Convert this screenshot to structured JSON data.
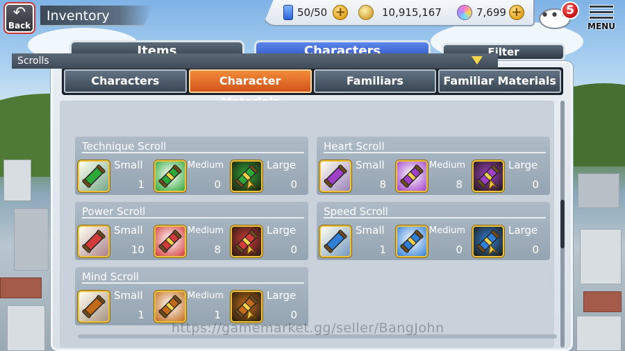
{
  "header": {
    "back_label": "Back",
    "title": "Inventory"
  },
  "status": {
    "energy": "50/50",
    "coins": "10,915,167",
    "gems": "7,699"
  },
  "chat": {
    "badge": "5",
    "dots": "•••"
  },
  "menu": {
    "label": "MENU"
  },
  "main_tabs": [
    {
      "label": "Items",
      "active": false
    },
    {
      "label": "Characters",
      "active": true
    }
  ],
  "filter_label": "Filter",
  "sub_tabs": [
    {
      "label": "Characters",
      "active": false
    },
    {
      "label": "Character Materials",
      "active": true
    },
    {
      "label": "Familiars",
      "active": false
    },
    {
      "label": "Familiar Materials",
      "active": false
    }
  ],
  "section": {
    "title": "Scrolls"
  },
  "cards": [
    {
      "title": "Technique Scroll",
      "color": "#2fa83a",
      "items": [
        {
          "size": "Small",
          "count": "1"
        },
        {
          "size": "Medium",
          "count": "0"
        },
        {
          "size": "Large",
          "count": "0"
        }
      ]
    },
    {
      "title": "Heart Scroll",
      "color": "#a040c8",
      "items": [
        {
          "size": "Small",
          "count": "8"
        },
        {
          "size": "Medium",
          "count": "8"
        },
        {
          "size": "Large",
          "count": "0"
        }
      ]
    },
    {
      "title": "Power Scroll",
      "color": "#d33a3a",
      "items": [
        {
          "size": "Small",
          "count": "10"
        },
        {
          "size": "Medium",
          "count": "8"
        },
        {
          "size": "Large",
          "count": "0"
        }
      ]
    },
    {
      "title": "Speed Scroll",
      "color": "#2f7fd6",
      "items": [
        {
          "size": "Small",
          "count": "1"
        },
        {
          "size": "Medium",
          "count": "0"
        },
        {
          "size": "Large",
          "count": "0"
        }
      ]
    },
    {
      "title": "Mind Scroll",
      "color": "#c26a1a",
      "items": [
        {
          "size": "Small",
          "count": "1"
        },
        {
          "size": "Medium",
          "count": "1"
        },
        {
          "size": "Large",
          "count": "0"
        }
      ]
    }
  ],
  "watermark": "https://gamemarket.gg/seller/BangJohn"
}
